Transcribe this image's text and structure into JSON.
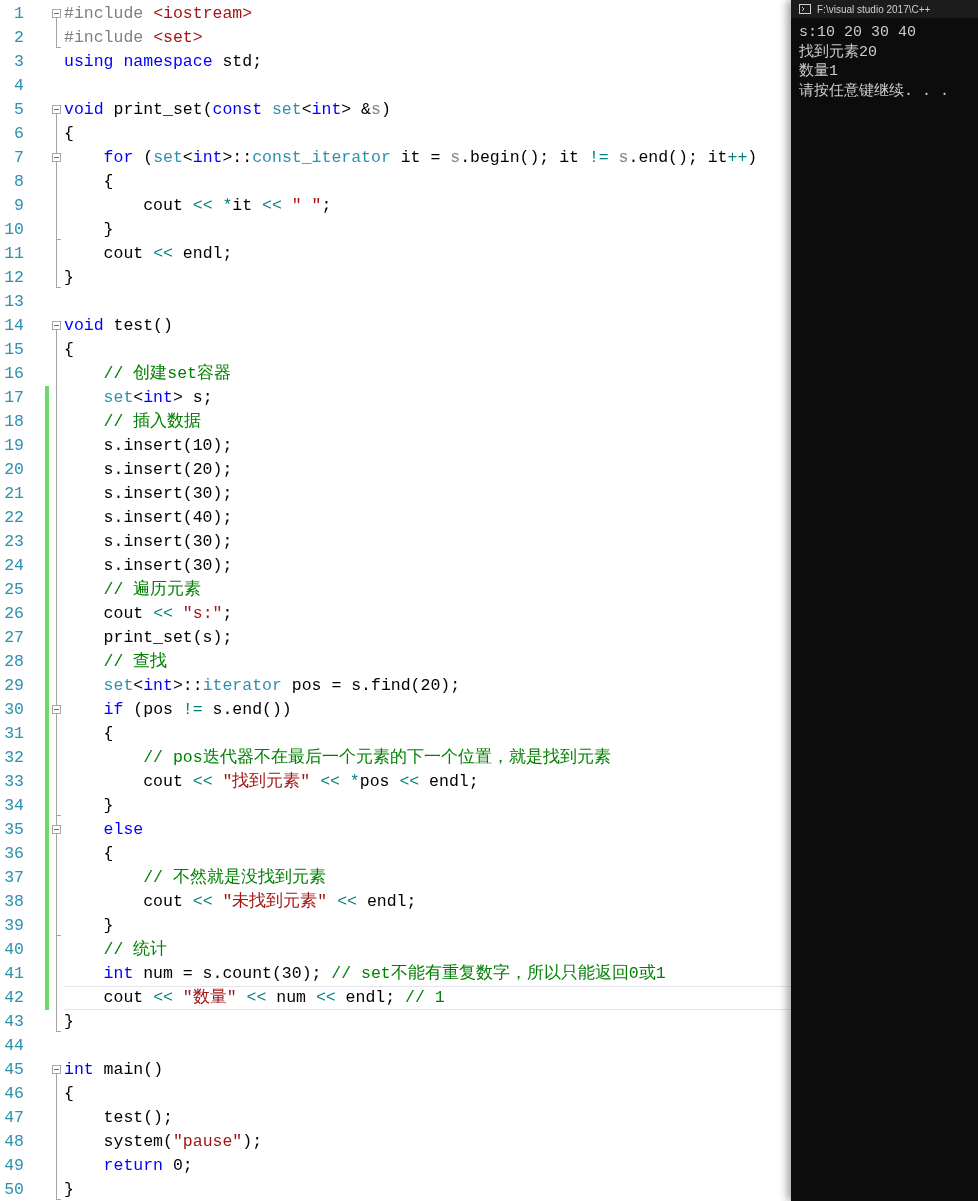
{
  "editor": {
    "lines": [
      {
        "number": "1",
        "foldable": true,
        "in_region": false,
        "region_end": false,
        "changed": false,
        "current": false,
        "tokens": [
          {
            "kind": "preproc",
            "text": "#include "
          },
          {
            "kind": "string",
            "text": "<iostream>"
          }
        ]
      },
      {
        "number": "2",
        "foldable": false,
        "in_region": true,
        "region_end": true,
        "changed": false,
        "current": false,
        "tokens": [
          {
            "kind": "preproc",
            "text": "#include "
          },
          {
            "kind": "string",
            "text": "<set>"
          }
        ]
      },
      {
        "number": "3",
        "foldable": false,
        "in_region": false,
        "region_end": false,
        "changed": false,
        "current": false,
        "tokens": [
          {
            "kind": "keyword",
            "text": "using "
          },
          {
            "kind": "keyword",
            "text": "namespace"
          },
          {
            "kind": "plain",
            "text": " std;"
          }
        ]
      },
      {
        "number": "4",
        "foldable": false,
        "in_region": false,
        "region_end": false,
        "changed": false,
        "current": false
      },
      {
        "number": "5",
        "foldable": true,
        "in_region": false,
        "region_end": false,
        "changed": false,
        "current": false,
        "tokens": [
          {
            "kind": "keyword",
            "text": "void"
          },
          {
            "kind": "plain",
            "text": " print_set("
          },
          {
            "kind": "keyword",
            "text": "const "
          },
          {
            "kind": "type",
            "text": "set"
          },
          {
            "kind": "plain",
            "text": "<"
          },
          {
            "kind": "keyword",
            "text": "int"
          },
          {
            "kind": "plain",
            "text": "> &"
          },
          {
            "kind": "param",
            "text": "s"
          },
          {
            "kind": "plain",
            "text": ")"
          }
        ]
      },
      {
        "number": "6",
        "foldable": false,
        "in_region": true,
        "region_end": false,
        "changed": false,
        "current": false,
        "tokens": [
          {
            "kind": "plain",
            "text": "{"
          }
        ]
      },
      {
        "number": "7",
        "foldable": true,
        "in_region": true,
        "region_end": false,
        "changed": false,
        "current": false,
        "tokens": [
          {
            "kind": "keyword",
            "text": "    for"
          },
          {
            "kind": "plain",
            "text": " ("
          },
          {
            "kind": "type",
            "text": "set"
          },
          {
            "kind": "plain",
            "text": "<"
          },
          {
            "kind": "keyword",
            "text": "int"
          },
          {
            "kind": "plain",
            "text": ">::"
          },
          {
            "kind": "type",
            "text": "const_iterator"
          },
          {
            "kind": "plain",
            "text": " it = "
          },
          {
            "kind": "param",
            "text": "s"
          },
          {
            "kind": "plain",
            "text": ".begin(); it "
          },
          {
            "kind": "operator",
            "text": "!= "
          },
          {
            "kind": "param",
            "text": "s"
          },
          {
            "kind": "plain",
            "text": ".end(); it"
          },
          {
            "kind": "operator",
            "text": "++"
          },
          {
            "kind": "plain",
            "text": ")"
          }
        ]
      },
      {
        "number": "8",
        "foldable": false,
        "in_region": true,
        "region_end": false,
        "changed": false,
        "current": false,
        "tokens": [
          {
            "kind": "plain",
            "text": "    {"
          }
        ]
      },
      {
        "number": "9",
        "foldable": false,
        "in_region": true,
        "region_end": false,
        "changed": false,
        "current": false,
        "tokens": [
          {
            "kind": "plain",
            "text": "        cout "
          },
          {
            "kind": "operator",
            "text": "<< *"
          },
          {
            "kind": "plain",
            "text": "it "
          },
          {
            "kind": "operator",
            "text": "<< "
          },
          {
            "kind": "string",
            "text": "\" \""
          },
          {
            "kind": "plain",
            "text": ";"
          }
        ]
      },
      {
        "number": "10",
        "foldable": false,
        "in_region": true,
        "region_end": true,
        "changed": false,
        "current": false,
        "tokens": [
          {
            "kind": "plain",
            "text": "    }"
          }
        ]
      },
      {
        "number": "11",
        "foldable": false,
        "in_region": true,
        "region_end": false,
        "changed": false,
        "current": false,
        "tokens": [
          {
            "kind": "plain",
            "text": "    cout "
          },
          {
            "kind": "operator",
            "text": "<<"
          },
          {
            "kind": "plain",
            "text": " endl;"
          }
        ]
      },
      {
        "number": "12",
        "foldable": false,
        "in_region": true,
        "region_end": true,
        "changed": false,
        "current": false,
        "tokens": [
          {
            "kind": "plain",
            "text": "}"
          }
        ]
      },
      {
        "number": "13",
        "foldable": false,
        "in_region": false,
        "region_end": false,
        "changed": false,
        "current": false
      },
      {
        "number": "14",
        "foldable": true,
        "in_region": false,
        "region_end": false,
        "changed": false,
        "current": false,
        "tokens": [
          {
            "kind": "keyword",
            "text": "void"
          },
          {
            "kind": "plain",
            "text": " test()"
          }
        ]
      },
      {
        "number": "15",
        "foldable": false,
        "in_region": true,
        "region_end": false,
        "changed": false,
        "current": false,
        "tokens": [
          {
            "kind": "plain",
            "text": "{"
          }
        ]
      },
      {
        "number": "16",
        "foldable": false,
        "in_region": true,
        "region_end": false,
        "changed": false,
        "current": false,
        "tokens": [
          {
            "kind": "comment",
            "text": "    // 创建set容器"
          }
        ]
      },
      {
        "number": "17",
        "foldable": false,
        "in_region": true,
        "region_end": false,
        "changed": true,
        "current": false,
        "tokens": [
          {
            "kind": "type",
            "text": "    set"
          },
          {
            "kind": "plain",
            "text": "<"
          },
          {
            "kind": "keyword",
            "text": "int"
          },
          {
            "kind": "plain",
            "text": "> s;"
          }
        ]
      },
      {
        "number": "18",
        "foldable": false,
        "in_region": true,
        "region_end": false,
        "changed": true,
        "current": false,
        "tokens": [
          {
            "kind": "comment",
            "text": "    // 插入数据"
          }
        ]
      },
      {
        "number": "19",
        "foldable": false,
        "in_region": true,
        "region_end": false,
        "changed": true,
        "current": false,
        "tokens": [
          {
            "kind": "plain",
            "text": "    s.insert(10);"
          }
        ]
      },
      {
        "number": "20",
        "foldable": false,
        "in_region": true,
        "region_end": false,
        "changed": true,
        "current": false,
        "tokens": [
          {
            "kind": "plain",
            "text": "    s.insert(20);"
          }
        ]
      },
      {
        "number": "21",
        "foldable": false,
        "in_region": true,
        "region_end": false,
        "changed": true,
        "current": false,
        "tokens": [
          {
            "kind": "plain",
            "text": "    s.insert(30);"
          }
        ]
      },
      {
        "number": "22",
        "foldable": false,
        "in_region": true,
        "region_end": false,
        "changed": true,
        "current": false,
        "tokens": [
          {
            "kind": "plain",
            "text": "    s.insert(40);"
          }
        ]
      },
      {
        "number": "23",
        "foldable": false,
        "in_region": true,
        "region_end": false,
        "changed": true,
        "current": false,
        "tokens": [
          {
            "kind": "plain",
            "text": "    s.insert(30);"
          }
        ]
      },
      {
        "number": "24",
        "foldable": false,
        "in_region": true,
        "region_end": false,
        "changed": true,
        "current": false,
        "tokens": [
          {
            "kind": "plain",
            "text": "    s.insert(30);"
          }
        ]
      },
      {
        "number": "25",
        "foldable": false,
        "in_region": true,
        "region_end": false,
        "changed": true,
        "current": false,
        "tokens": [
          {
            "kind": "comment",
            "text": "    // 遍历元素"
          }
        ]
      },
      {
        "number": "26",
        "foldable": false,
        "in_region": true,
        "region_end": false,
        "changed": true,
        "current": false,
        "tokens": [
          {
            "kind": "plain",
            "text": "    cout "
          },
          {
            "kind": "operator",
            "text": "<< "
          },
          {
            "kind": "string",
            "text": "\"s:\""
          },
          {
            "kind": "plain",
            "text": ";"
          }
        ]
      },
      {
        "number": "27",
        "foldable": false,
        "in_region": true,
        "region_end": false,
        "changed": true,
        "current": false,
        "tokens": [
          {
            "kind": "plain",
            "text": "    print_set(s);"
          }
        ]
      },
      {
        "number": "28",
        "foldable": false,
        "in_region": true,
        "region_end": false,
        "changed": true,
        "current": false,
        "tokens": [
          {
            "kind": "comment",
            "text": "    // 查找"
          }
        ]
      },
      {
        "number": "29",
        "foldable": false,
        "in_region": true,
        "region_end": false,
        "changed": true,
        "current": false,
        "tokens": [
          {
            "kind": "type",
            "text": "    set"
          },
          {
            "kind": "plain",
            "text": "<"
          },
          {
            "kind": "keyword",
            "text": "int"
          },
          {
            "kind": "plain",
            "text": ">::"
          },
          {
            "kind": "type",
            "text": "iterator"
          },
          {
            "kind": "plain",
            "text": " pos = s.find(20);"
          }
        ]
      },
      {
        "number": "30",
        "foldable": true,
        "in_region": true,
        "region_end": false,
        "changed": true,
        "current": false,
        "tokens": [
          {
            "kind": "keyword",
            "text": "    if"
          },
          {
            "kind": "plain",
            "text": " (pos "
          },
          {
            "kind": "operator",
            "text": "!="
          },
          {
            "kind": "plain",
            "text": " s.end())"
          }
        ]
      },
      {
        "number": "31",
        "foldable": false,
        "in_region": true,
        "region_end": false,
        "changed": true,
        "current": false,
        "tokens": [
          {
            "kind": "plain",
            "text": "    {"
          }
        ]
      },
      {
        "number": "32",
        "foldable": false,
        "in_region": true,
        "region_end": false,
        "changed": true,
        "current": false,
        "tokens": [
          {
            "kind": "comment",
            "text": "        // pos迭代器不在最后一个元素的下一个位置，就是找到元素"
          }
        ]
      },
      {
        "number": "33",
        "foldable": false,
        "in_region": true,
        "region_end": false,
        "changed": true,
        "current": false,
        "tokens": [
          {
            "kind": "plain",
            "text": "        cout "
          },
          {
            "kind": "operator",
            "text": "<< "
          },
          {
            "kind": "string",
            "text": "\"找到元素\""
          },
          {
            "kind": "operator",
            "text": " << *"
          },
          {
            "kind": "plain",
            "text": "pos "
          },
          {
            "kind": "operator",
            "text": "<<"
          },
          {
            "kind": "plain",
            "text": " endl;"
          }
        ]
      },
      {
        "number": "34",
        "foldable": false,
        "in_region": true,
        "region_end": true,
        "changed": true,
        "current": false,
        "tokens": [
          {
            "kind": "plain",
            "text": "    }"
          }
        ]
      },
      {
        "number": "35",
        "foldable": true,
        "in_region": true,
        "region_end": false,
        "changed": true,
        "current": false,
        "tokens": [
          {
            "kind": "keyword",
            "text": "    else"
          }
        ]
      },
      {
        "number": "36",
        "foldable": false,
        "in_region": true,
        "region_end": false,
        "changed": true,
        "current": false,
        "tokens": [
          {
            "kind": "plain",
            "text": "    {"
          }
        ]
      },
      {
        "number": "37",
        "foldable": false,
        "in_region": true,
        "region_end": false,
        "changed": true,
        "current": false,
        "tokens": [
          {
            "kind": "comment",
            "text": "        // 不然就是没找到元素"
          }
        ]
      },
      {
        "number": "38",
        "foldable": false,
        "in_region": true,
        "region_end": false,
        "changed": true,
        "current": false,
        "tokens": [
          {
            "kind": "plain",
            "text": "        cout "
          },
          {
            "kind": "operator",
            "text": "<< "
          },
          {
            "kind": "string",
            "text": "\"未找到元素\""
          },
          {
            "kind": "operator",
            "text": " <<"
          },
          {
            "kind": "plain",
            "text": " endl;"
          }
        ]
      },
      {
        "number": "39",
        "foldable": false,
        "in_region": true,
        "region_end": true,
        "changed": true,
        "current": false,
        "tokens": [
          {
            "kind": "plain",
            "text": "    }"
          }
        ]
      },
      {
        "number": "40",
        "foldable": false,
        "in_region": true,
        "region_end": false,
        "changed": true,
        "current": false,
        "tokens": [
          {
            "kind": "comment",
            "text": "    // 统计"
          }
        ]
      },
      {
        "number": "41",
        "foldable": false,
        "in_region": true,
        "region_end": false,
        "changed": true,
        "current": false,
        "tokens": [
          {
            "kind": "keyword",
            "text": "    int"
          },
          {
            "kind": "plain",
            "text": " num = s.count(30); "
          },
          {
            "kind": "comment",
            "text": "// set不能有重复数字，所以只能返回0或1"
          }
        ]
      },
      {
        "number": "42",
        "foldable": false,
        "in_region": true,
        "region_end": false,
        "changed": true,
        "current": true,
        "tokens": [
          {
            "kind": "plain",
            "text": "    cout "
          },
          {
            "kind": "operator",
            "text": "<< "
          },
          {
            "kind": "string",
            "text": "\"数量\""
          },
          {
            "kind": "operator",
            "text": " <<"
          },
          {
            "kind": "plain",
            "text": " num "
          },
          {
            "kind": "operator",
            "text": "<<"
          },
          {
            "kind": "plain",
            "text": " endl; "
          },
          {
            "kind": "comment",
            "text": "// 1"
          }
        ]
      },
      {
        "number": "43",
        "foldable": false,
        "in_region": true,
        "region_end": true,
        "changed": false,
        "current": false,
        "tokens": [
          {
            "kind": "plain",
            "text": "}"
          }
        ]
      },
      {
        "number": "44",
        "foldable": false,
        "in_region": false,
        "region_end": false,
        "changed": false,
        "current": false
      },
      {
        "number": "45",
        "foldable": true,
        "in_region": false,
        "region_end": false,
        "changed": false,
        "current": false,
        "tokens": [
          {
            "kind": "keyword",
            "text": "int"
          },
          {
            "kind": "plain",
            "text": " main()"
          }
        ]
      },
      {
        "number": "46",
        "foldable": false,
        "in_region": true,
        "region_end": false,
        "changed": false,
        "current": false,
        "tokens": [
          {
            "kind": "plain",
            "text": "{"
          }
        ]
      },
      {
        "number": "47",
        "foldable": false,
        "in_region": true,
        "region_end": false,
        "changed": false,
        "current": false,
        "tokens": [
          {
            "kind": "plain",
            "text": "    test();"
          }
        ]
      },
      {
        "number": "48",
        "foldable": false,
        "in_region": true,
        "region_end": false,
        "changed": false,
        "current": false,
        "tokens": [
          {
            "kind": "plain",
            "text": "    system("
          },
          {
            "kind": "string",
            "text": "\"pause\""
          },
          {
            "kind": "plain",
            "text": ");"
          }
        ]
      },
      {
        "number": "49",
        "foldable": false,
        "in_region": true,
        "region_end": false,
        "changed": false,
        "current": false,
        "tokens": [
          {
            "kind": "keyword",
            "text": "    return"
          },
          {
            "kind": "plain",
            "text": " 0;"
          }
        ]
      },
      {
        "number": "50",
        "foldable": false,
        "in_region": true,
        "region_end": true,
        "changed": false,
        "current": false,
        "tokens": [
          {
            "kind": "plain",
            "text": "}"
          }
        ]
      }
    ]
  },
  "console": {
    "title": "F:\\visual studio 2017\\C++",
    "lines": [
      "s:10 20 30 40",
      "找到元素20",
      "数量1",
      "请按任意键继续. . ."
    ]
  }
}
